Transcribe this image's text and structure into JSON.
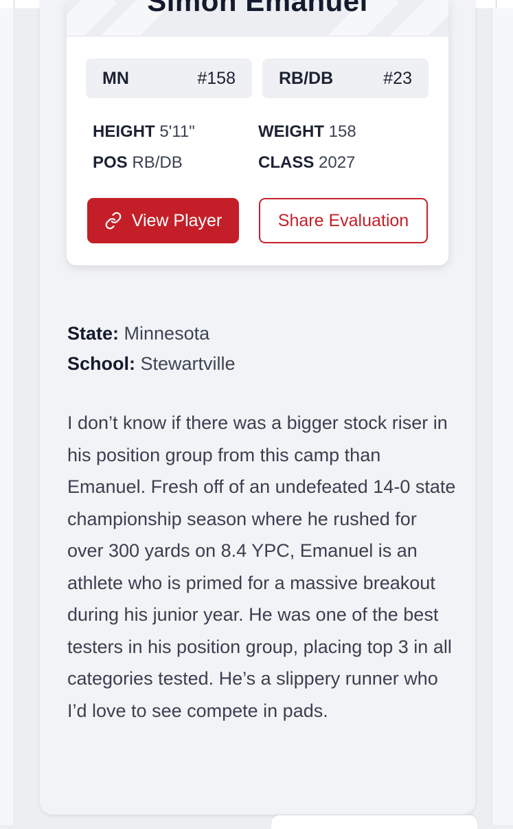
{
  "player": {
    "name": "Simon Emanuel",
    "state_abbr": "MN",
    "state_rank": "#158",
    "position_abbr": "RB/DB",
    "position_rank": "#23"
  },
  "stats": {
    "height_label": "HEIGHT",
    "height_value": "5'11\"",
    "weight_label": "WEIGHT",
    "weight_value": "158",
    "pos_label": "POS",
    "pos_value": "RB/DB",
    "class_label": "CLASS",
    "class_value": "2027"
  },
  "actions": {
    "view_player_label": "View Player",
    "share_label": "Share Evaluation"
  },
  "info": {
    "state_label": "State:",
    "state_value": "Minnesota",
    "school_label": "School:",
    "school_value": "Stewartville"
  },
  "evaluation": {
    "text": "I don’t know if there was a bigger stock riser in his position group from this camp than Emanuel. Fresh off of an undefeated 14-0 state championship season where he rushed for over 300 yards on 8.4 YPC, Emanuel is an athlete who is primed for a massive breakout during his junior year. He was one of the best testers in his position group, placing top 3 in all categories tested. He’s a slippery runner who I’d love to see compete in pads."
  },
  "colors": {
    "brand_red": "#c41f28",
    "page_bg": "#eceef2",
    "card_bg": "#ffffff"
  },
  "icons": {
    "view_player_icon": "link-icon"
  }
}
